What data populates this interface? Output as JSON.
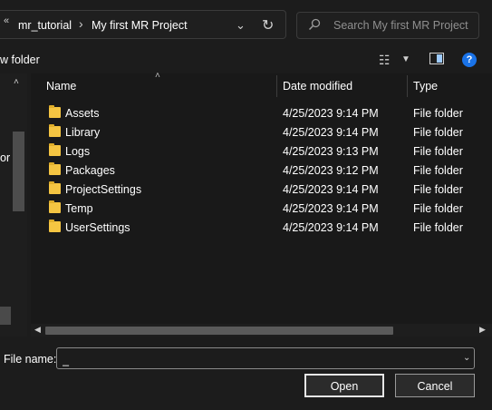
{
  "address_bar": {
    "overflow_chevron": "«",
    "breadcrumbs": [
      "mr_tutorial",
      "My first MR Project"
    ],
    "separator": "›",
    "dropdown_glyph": "⌄",
    "refresh_glyph": "↻"
  },
  "search": {
    "placeholder": "Search My first MR Project",
    "icon": "search-icon"
  },
  "toolbar": {
    "new_folder_label": "w folder",
    "view_glyph": "☷",
    "view_dropdown_glyph": "▼",
    "help_glyph": "?"
  },
  "nav_pane": {
    "partial_text": "or",
    "scroll_up_glyph": "˄"
  },
  "columns": {
    "name": "Name",
    "date_modified": "Date modified",
    "type": "Type",
    "sort_glyph": "˄"
  },
  "files": [
    {
      "name": "Assets",
      "date": "4/25/2023 9:14 PM",
      "type": "File folder"
    },
    {
      "name": "Library",
      "date": "4/25/2023 9:14 PM",
      "type": "File folder"
    },
    {
      "name": "Logs",
      "date": "4/25/2023 9:13 PM",
      "type": "File folder"
    },
    {
      "name": "Packages",
      "date": "4/25/2023 9:12 PM",
      "type": "File folder"
    },
    {
      "name": "ProjectSettings",
      "date": "4/25/2023 9:14 PM",
      "type": "File folder"
    },
    {
      "name": "Temp",
      "date": "4/25/2023 9:14 PM",
      "type": "File folder"
    },
    {
      "name": "UserSettings",
      "date": "4/25/2023 9:14 PM",
      "type": "File folder"
    }
  ],
  "scrollbar": {
    "left_glyph": "◀",
    "right_glyph": "▶"
  },
  "bottom": {
    "file_name_label": "File name:",
    "file_name_value": "_",
    "dropdown_glyph": "⌄",
    "open_label": "Open",
    "cancel_label": "Cancel"
  },
  "colors": {
    "background": "#1c1c1c",
    "folder": "#f5c542",
    "help_accent": "#1a73e8"
  }
}
